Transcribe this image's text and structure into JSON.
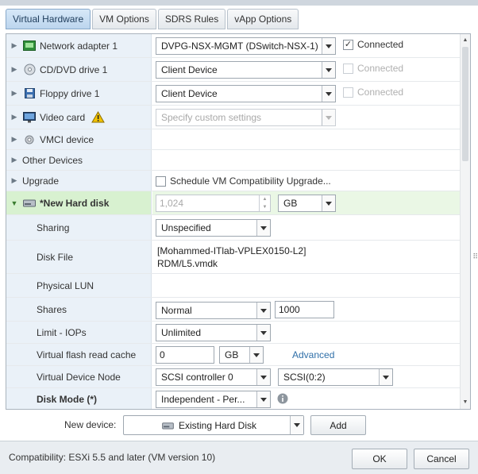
{
  "tabs": [
    "Virtual Hardware",
    "VM Options",
    "SDRS Rules",
    "vApp Options"
  ],
  "rows": {
    "network": {
      "label": "Network adapter 1",
      "value": "DVPG-NSX-MGMT (DSwitch-NSX-1)",
      "connected": "Connected"
    },
    "cddvd": {
      "label": "CD/DVD drive 1",
      "value": "Client Device",
      "connected": "Connected"
    },
    "floppy": {
      "label": "Floppy drive 1",
      "value": "Client Device",
      "connected": "Connected"
    },
    "video": {
      "label": "Video card",
      "value": "Specify custom settings"
    },
    "vmci": {
      "label": "VMCI device"
    },
    "other": {
      "label": "Other Devices"
    },
    "upgrade": {
      "label": "Upgrade",
      "value": "Schedule VM Compatibility Upgrade..."
    },
    "newdisk": {
      "label": "*New Hard disk",
      "size": "1,024",
      "unit": "GB"
    },
    "sharing": {
      "label": "Sharing",
      "value": "Unspecified"
    },
    "diskfile": {
      "label": "Disk File",
      "line1": "[Mohammed-ITlab-VPLEX0150-L2]",
      "line2": "RDM/L5.vmdk"
    },
    "lun": {
      "label": "Physical LUN"
    },
    "shares": {
      "label": "Shares",
      "value": "Normal",
      "amount": "1000"
    },
    "iops": {
      "label": "Limit - IOPs",
      "value": "Unlimited"
    },
    "flash": {
      "label": "Virtual flash read cache",
      "value": "0",
      "unit": "GB",
      "link": "Advanced"
    },
    "node": {
      "label": "Virtual Device Node",
      "controller": "SCSI controller 0",
      "slot": "SCSI(0:2)"
    },
    "mode": {
      "label": "Disk Mode (*)",
      "value": "Independent - Per..."
    }
  },
  "newdevice": {
    "label": "New device:",
    "value": "Existing Hard Disk",
    "add": "Add"
  },
  "footer": {
    "compat": "Compatibility: ESXi 5.5 and later (VM version 10)",
    "ok": "OK",
    "cancel": "Cancel"
  },
  "colors": {
    "tab_active": "#bcd5ee",
    "label_bg": "#eaf1f8",
    "selected_bg": "#d8f1d0",
    "link": "#2f6fa8",
    "warning": "#f2c200"
  },
  "icons": [
    "network-adapter-icon",
    "cd-dvd-icon",
    "floppy-icon",
    "video-card-icon",
    "warning-icon",
    "vmci-icon",
    "hard-disk-icon",
    "info-icon"
  ]
}
